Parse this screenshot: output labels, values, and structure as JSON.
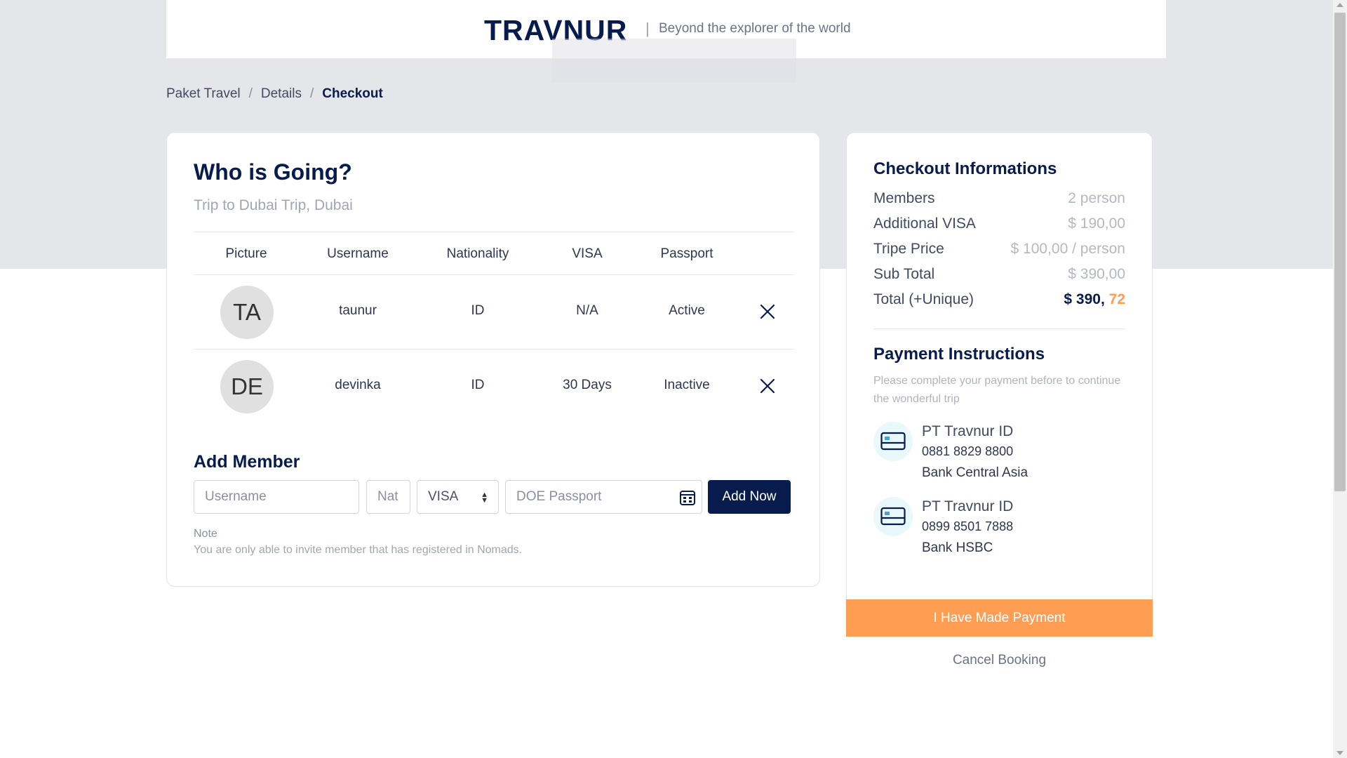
{
  "header": {
    "brand": "TRAVNUR",
    "separator": "|",
    "tagline": "Beyond the explorer of the world"
  },
  "breadcrumb": {
    "items": [
      "Paket Travel",
      "Details",
      "Checkout"
    ],
    "separator": "/"
  },
  "members_card": {
    "title": "Who is Going?",
    "subtitle": "Trip to Dubai Trip, Dubai",
    "columns": [
      "Picture",
      "Username",
      "Nationality",
      "VISA",
      "Passport"
    ],
    "rows": [
      {
        "initials": "TA",
        "username": "taunur",
        "nationality": "ID",
        "visa": "N/A",
        "passport": "Active",
        "remove_icon": "close-icon"
      },
      {
        "initials": "DE",
        "username": "devinka",
        "nationality": "ID",
        "visa": "30 Days",
        "passport": "Inactive",
        "remove_icon": "close-icon"
      }
    ],
    "add_member": {
      "title": "Add Member",
      "username_placeholder": "Username",
      "nationality_placeholder": "Nat",
      "visa_selected": "VISA",
      "doe_placeholder": "DOE Passport",
      "button": "Add Now"
    },
    "note_label": "Note",
    "note_text": "You are only able to invite member that has registered in Nomads."
  },
  "checkout": {
    "title": "Checkout Informations",
    "rows": [
      {
        "label": "Members",
        "value": "2 person"
      },
      {
        "label": "Additional VISA",
        "value": "$ 190,00"
      },
      {
        "label": "Tripe Price",
        "value": "$ 100,00 / person"
      },
      {
        "label": "Sub Total",
        "value": "$ 390,00"
      }
    ],
    "total_label": "Total (+Unique)",
    "total_main": "$ 390,",
    "total_unique": "72",
    "payment_title": "Payment Instructions",
    "payment_text": "Please complete your payment before to continue the wonderful trip",
    "banks": [
      {
        "name": "PT Travnur ID",
        "account": "0881 8829 8800",
        "bank": "Bank Central Asia",
        "icon": "credit-card-icon"
      },
      {
        "name": "PT Travnur ID",
        "account": "0899 8501 7888",
        "bank": "Bank HSBC",
        "icon": "credit-card-icon"
      }
    ],
    "paid_button": "I Have Made Payment",
    "cancel_link": "Cancel Booking"
  },
  "colors": {
    "primary": "#071c4d",
    "accent": "#ff9e53",
    "band": "#e5e6ea"
  }
}
